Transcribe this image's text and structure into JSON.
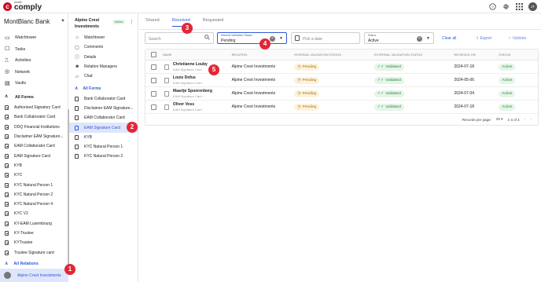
{
  "app": {
    "brand_small": "wealth",
    "brand_big": "comply",
    "user_initials": "JT"
  },
  "top_icons": [
    "help-icon",
    "settings-icon",
    "apps-grid-icon"
  ],
  "sidebar": {
    "org": "MontBlanc Bank",
    "nav": [
      {
        "label": "Watchtower",
        "icon": "watchtower-icon"
      },
      {
        "label": "Tasks",
        "icon": "tasks-icon"
      },
      {
        "label": "Activities",
        "icon": "activities-icon"
      },
      {
        "label": "Network",
        "icon": "network-icon"
      },
      {
        "label": "Vaults",
        "icon": "vault-icon"
      }
    ],
    "forms_group": "All Forms",
    "forms": [
      "Authorised Signatory Card",
      "Bank Collaborator Card",
      "DDQ Financial Institutions",
      "Disclaimer EAM Signature...",
      "EAM Collaborator Card",
      "EAM Signature Card",
      "KYB",
      "KYC",
      "KYC Natural Person 1",
      "KYC Natural Person 2",
      "KYC Natural Person 4",
      "KYC V2",
      "KY-EAM Luxembourg",
      "KY-Trustee",
      "KYTrustee",
      "Trustee Signature card"
    ],
    "relations_group": "All Relations",
    "selected_relation": "Alpine Crest Investments"
  },
  "relation_panel": {
    "title": "Alpine Crest Investments",
    "status_badge": "Active",
    "nav": [
      {
        "label": "Watchtower",
        "icon": "home-icon"
      },
      {
        "label": "Comments",
        "icon": "comment-icon"
      },
      {
        "label": "Details",
        "icon": "info-icon"
      },
      {
        "label": "Relation Managers",
        "icon": "people-icon"
      },
      {
        "label": "Chat",
        "icon": "chat-icon"
      }
    ],
    "forms_group": "All Forms",
    "forms": [
      "Bank Collaborator Card",
      "Disclaimer EAM Signature...",
      "EAM Collaborator Card",
      "EAM Signature Card",
      "KYB",
      "KYC Natural Person 1",
      "KYC Natural Person 2"
    ],
    "active_form_index": 3
  },
  "main": {
    "tabs": [
      "Shared",
      "Received",
      "Requested"
    ],
    "active_tab": 1,
    "search_placeholder": "Search",
    "ivs_filter": {
      "label": "Internal Validation Status",
      "value": "Pending"
    },
    "date_placeholder": "Pick a date",
    "status_filter": {
      "label": "Status",
      "value": "Active"
    },
    "clear_all": "Clear all",
    "export": "Export",
    "validate": "Validate",
    "columns": [
      "Name",
      "Relation",
      "Internal Validation Status",
      "External Validation Status",
      "Received On",
      "Status"
    ],
    "rows": [
      {
        "name": "Christianne Louby",
        "form": "EAM Signature Card",
        "relation": "Alpine Crest Investments",
        "ivs": "Pending",
        "evs": "Validated",
        "received": "2024-07-18",
        "status": "Active"
      },
      {
        "name": "Louis Dofus",
        "form": "EAM Signature Card",
        "relation": "Alpine Crest Investments",
        "ivs": "Pending",
        "evs": "Validated",
        "received": "2024-05-06",
        "status": "Active"
      },
      {
        "name": "Maartje Spoorenberg",
        "form": "EAM Signature Card ...",
        "relation": "Alpine Crest Investments",
        "ivs": "Pending",
        "evs": "Validated",
        "received": "2024-07-04",
        "status": "Active"
      },
      {
        "name": "Oliver Voss",
        "form": "EAM Signature Card",
        "relation": "Alpine Crest Investments",
        "ivs": "Pending",
        "evs": "Validated",
        "received": "2024-07-18",
        "status": "Active"
      }
    ],
    "pager": {
      "label": "Records per page:",
      "per_page": "25",
      "range": "1-4 of 4"
    }
  },
  "markers": [
    "1",
    "2",
    "3",
    "4",
    "5"
  ]
}
